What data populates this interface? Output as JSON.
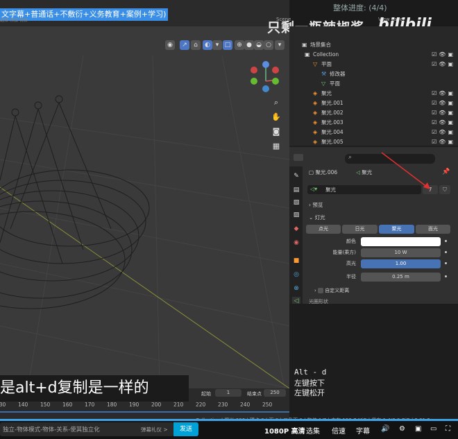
{
  "header": {
    "banner": "文字幕+普通话+不敷衍+义务教育+案例+学习)",
    "menu_tiny": "选择  添加  物体",
    "progress": "整体进度: (4/4)",
    "watermark": "只剩一瓶辣椒酱",
    "bili": "bilibili",
    "scene_label": "Scene",
    "view_layer": "View Layer"
  },
  "outliner": {
    "title": "场景集合",
    "rows": [
      {
        "label": "Collection",
        "indent": 1,
        "icon": "collection-icon"
      },
      {
        "label": "平面",
        "indent": 2,
        "icon": "mesh-icon"
      },
      {
        "label": "修改器",
        "indent": 3,
        "icon": "wrench-icon"
      },
      {
        "label": "平面",
        "indent": 3,
        "icon": "mesh-data-icon"
      },
      {
        "label": "聚光",
        "indent": 2,
        "icon": "spotlight-icon"
      },
      {
        "label": "聚光.001",
        "indent": 2,
        "icon": "spotlight-icon"
      },
      {
        "label": "聚光.002",
        "indent": 2,
        "icon": "spotlight-icon"
      },
      {
        "label": "聚光.003",
        "indent": 2,
        "icon": "spotlight-icon"
      },
      {
        "label": "聚光.004",
        "indent": 2,
        "icon": "spotlight-icon"
      },
      {
        "label": "聚光.005",
        "indent": 2,
        "icon": "spotlight-icon"
      },
      {
        "label": "聚光.006",
        "indent": 2,
        "icon": "spotlight-icon"
      }
    ]
  },
  "properties": {
    "object_name": "聚光.006",
    "data_name": "聚光",
    "datablock_name": "聚光",
    "user_count": "7",
    "preview_section": "预览",
    "light_section": "灯光",
    "light_types": [
      "点光",
      "日光",
      "聚光",
      "面光"
    ],
    "active_type": "聚光",
    "fields": {
      "color_label": "颜色",
      "power_label": "能量(乘方)",
      "power_value": "10 W",
      "specular_label": "高光",
      "specular_value": "1.00",
      "radius_label": "半径",
      "radius_value": "0.25 m",
      "custom_distance": "自定义距离",
      "next_section": "光圈形状"
    },
    "color_value": "#ffffff"
  },
  "timeline": {
    "start_label": "起始",
    "start_value": "1",
    "end_label": "结束点",
    "end_value": "250",
    "ticks": [
      "130",
      "140",
      "150",
      "160",
      "170",
      "180",
      "190",
      "200",
      "210",
      "220",
      "230",
      "240",
      "250"
    ]
  },
  "subtitle": "是alt+d复制是一样的",
  "shortcuts": [
    "Alt - d",
    "左键按下",
    "左键松开"
  ],
  "statusbar": "Collection | 聚光.006 | 顶点:0 | 面:0 | 三角面:0 | 物体:1/7 | 内存:153.7 MiB | 显存:1.4/6.0 GiB | 2.91.2",
  "player": {
    "danmaku_placeholder": "独立-物体模式-物体-关系-使其独立化",
    "etiquette": "弹幕礼仪 >",
    "send": "发送",
    "quality": "1080P 高清",
    "select": "选集",
    "speed": "倍速",
    "subtitle_btn": "字幕"
  }
}
